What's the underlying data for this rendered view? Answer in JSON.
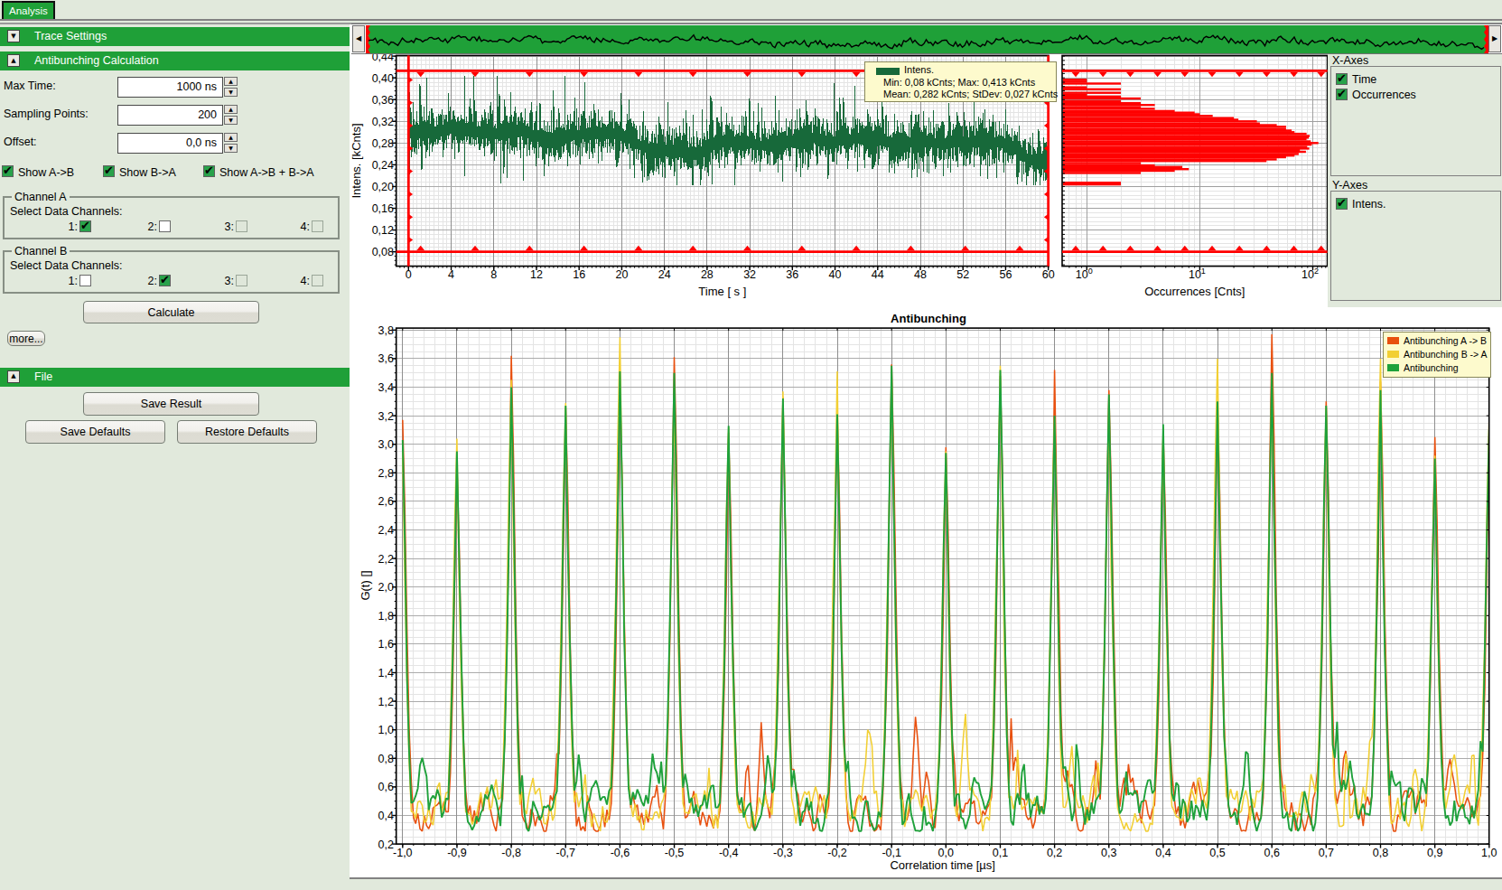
{
  "window": {
    "tab_label": "Analysis"
  },
  "sidebar": {
    "sections": {
      "trace_settings": "Trace Settings",
      "antibunching_calculation": "Antibunching Calculation",
      "file": "File"
    },
    "fields": [
      {
        "label": "Max Time:",
        "value": "1000 ns"
      },
      {
        "label": "Sampling Points:",
        "value": "200"
      },
      {
        "label": "Offset:",
        "value": "0,0 ns"
      }
    ],
    "show_options": [
      {
        "label": "Show A->B",
        "checked": true
      },
      {
        "label": "Show B->A",
        "checked": true
      },
      {
        "label": "Show A->B + B->A",
        "checked": true
      }
    ],
    "channel_a": {
      "title": "Channel A",
      "select_label": "Select Data Channels:",
      "channels": [
        {
          "label": "1:",
          "checked": true,
          "enabled": true
        },
        {
          "label": "2:",
          "checked": false,
          "enabled": true
        },
        {
          "label": "3:",
          "checked": false,
          "enabled": false
        },
        {
          "label": "4:",
          "checked": false,
          "enabled": false
        }
      ]
    },
    "channel_b": {
      "title": "Channel B",
      "select_label": "Select Data Channels:",
      "channels": [
        {
          "label": "1:",
          "checked": false,
          "enabled": true
        },
        {
          "label": "2:",
          "checked": true,
          "enabled": true
        },
        {
          "label": "3:",
          "checked": false,
          "enabled": false
        },
        {
          "label": "4:",
          "checked": false,
          "enabled": false
        }
      ]
    },
    "buttons": {
      "calculate": "Calculate",
      "more": "more...",
      "save_result": "Save Result",
      "save_defaults": "Save Defaults",
      "restore_defaults": "Restore Defaults"
    }
  },
  "axes_panel": {
    "x_title": "X-Axes",
    "x_items": [
      {
        "label": "Time",
        "checked": true
      },
      {
        "label": "Occurrences",
        "checked": true
      }
    ],
    "y_title": "Y-Axes",
    "y_items": [
      {
        "label": "Intens.",
        "checked": true
      }
    ]
  },
  "colors": {
    "accent_green": "#1fa038",
    "trace_dark_green": "#17693a",
    "marker_red": "#ff0000",
    "series_orange": "#e8500f",
    "series_yellow": "#f2cf33",
    "series_green": "#1ea13b",
    "legend_bg": "#fdfacd",
    "panel_bg": "#e1e9dc"
  },
  "chart_data": [
    {
      "id": "overview_trace",
      "type": "line",
      "role": "time-trace overview scrollbar",
      "bg_color": "#1fa038",
      "line_color": "#000000",
      "x_range_s": [
        0,
        60
      ],
      "seed": 101
    },
    {
      "id": "intensity_time_trace",
      "type": "line",
      "title": "",
      "xlabel": "Time [ s ]",
      "ylabel": "Intens. [kCnts]",
      "xlim": [
        -1.15,
        60.05
      ],
      "xticks": [
        0,
        4,
        8,
        12,
        16,
        20,
        24,
        28,
        32,
        36,
        40,
        44,
        48,
        52,
        56,
        60
      ],
      "ylim": [
        0.053,
        0.441
      ],
      "yticks": [
        0.08,
        0.12,
        0.16,
        0.2,
        0.24,
        0.28,
        0.32,
        0.36,
        0.4,
        0.44
      ],
      "grid": true,
      "series": [
        {
          "name": "Intens.",
          "color": "#17693a",
          "min_kcnts": 0.08,
          "max_kcnts": 0.413,
          "mean_kcnts": 0.282,
          "stdev_kcnts": 0.027,
          "sigma": 0.0265,
          "seed": 7,
          "mean_profile": [
            [
              0,
              0.298
            ],
            [
              1,
              0.302
            ],
            [
              3,
              0.3
            ],
            [
              4,
              0.308
            ],
            [
              5,
              0.305
            ],
            [
              6,
              0.302
            ],
            [
              7,
              0.3
            ],
            [
              8,
              0.296
            ],
            [
              9,
              0.3
            ],
            [
              10,
              0.305
            ],
            [
              11,
              0.3
            ],
            [
              12,
              0.292
            ],
            [
              13,
              0.285
            ],
            [
              14,
              0.29
            ],
            [
              15,
              0.298
            ],
            [
              16,
              0.295
            ],
            [
              17,
              0.3
            ],
            [
              18,
              0.3
            ],
            [
              19,
              0.298
            ],
            [
              20,
              0.295
            ],
            [
              21,
              0.285
            ],
            [
              22,
              0.272
            ],
            [
              23,
              0.266
            ],
            [
              24,
              0.264
            ],
            [
              25,
              0.266
            ],
            [
              26,
              0.264
            ],
            [
              27,
              0.262
            ],
            [
              28,
              0.268
            ],
            [
              29,
              0.282
            ],
            [
              30,
              0.284
            ],
            [
              31,
              0.28
            ],
            [
              32,
              0.279
            ],
            [
              33,
              0.276
            ],
            [
              34,
              0.278
            ],
            [
              35,
              0.281
            ],
            [
              36,
              0.284
            ],
            [
              37,
              0.288
            ],
            [
              38,
              0.29
            ],
            [
              39,
              0.285
            ],
            [
              40,
              0.283
            ],
            [
              41,
              0.286
            ],
            [
              42,
              0.289
            ],
            [
              43,
              0.293
            ],
            [
              44,
              0.291
            ],
            [
              45,
              0.282
            ],
            [
              46,
              0.278
            ],
            [
              47,
              0.28
            ],
            [
              48,
              0.283
            ],
            [
              49,
              0.281
            ],
            [
              50,
              0.279
            ],
            [
              51,
              0.283
            ],
            [
              52,
              0.279
            ],
            [
              53,
              0.281
            ],
            [
              54,
              0.284
            ],
            [
              55,
              0.282
            ],
            [
              56,
              0.278
            ],
            [
              57,
              0.268
            ],
            [
              58,
              0.252
            ],
            [
              59,
              0.245
            ],
            [
              60,
              0.238
            ]
          ]
        }
      ],
      "range_cursors": {
        "color": "#ff0000",
        "x_values": [
          0,
          60
        ],
        "y_values": [
          0.08,
          0.413
        ]
      },
      "tooltip": {
        "title": "Intens.",
        "line1": "Min: 0,08 kCnts; Max: 0,413 kCnts",
        "line2": "Mean: 0,282 kCnts; StDev: 0,027 kCnts"
      }
    },
    {
      "id": "intensity_histogram",
      "type": "bar",
      "orientation": "horizontal",
      "xlabel": "Occurrences [Cnts]",
      "x_scale": "log",
      "xticks": [
        1,
        10,
        100
      ],
      "xtick_labels": [
        "10",
        "10",
        "10"
      ],
      "xtick_exponents": [
        "0",
        "1",
        "2"
      ],
      "ylim": [
        0.053,
        0.441
      ],
      "bar_color": "#ff0000",
      "bin_size_kcnts": 0.004,
      "range_cursors": {
        "color": "#ff0000",
        "y_values": [
          0.08,
          0.413
        ]
      },
      "bars_intensity_count": [
        [
          0.204,
          2
        ],
        [
          0.207,
          2
        ],
        [
          0.225,
          3
        ],
        [
          0.229,
          6
        ],
        [
          0.232,
          8
        ],
        [
          0.236,
          7
        ],
        [
          0.239,
          4
        ],
        [
          0.243,
          3
        ],
        [
          0.247,
          39
        ],
        [
          0.25,
          48
        ],
        [
          0.254,
          58
        ],
        [
          0.257,
          69
        ],
        [
          0.26,
          75
        ],
        [
          0.264,
          87
        ],
        [
          0.267,
          77
        ],
        [
          0.27,
          93
        ],
        [
          0.273,
          89
        ],
        [
          0.277,
          98
        ],
        [
          0.28,
          112
        ],
        [
          0.283,
          96
        ],
        [
          0.287,
          88
        ],
        [
          0.29,
          92
        ],
        [
          0.293,
          94
        ],
        [
          0.297,
          88
        ],
        [
          0.3,
          69
        ],
        [
          0.303,
          65
        ],
        [
          0.306,
          58
        ],
        [
          0.31,
          58
        ],
        [
          0.313,
          48
        ],
        [
          0.316,
          34
        ],
        [
          0.32,
          32
        ],
        [
          0.323,
          22
        ],
        [
          0.326,
          20
        ],
        [
          0.33,
          13
        ],
        [
          0.333,
          10
        ],
        [
          0.336,
          9
        ],
        [
          0.339,
          6
        ],
        [
          0.343,
          4
        ],
        [
          0.346,
          3
        ],
        [
          0.35,
          4
        ],
        [
          0.3535,
          3
        ],
        [
          0.357,
          2
        ],
        [
          0.362,
          3
        ],
        [
          0.3655,
          2
        ],
        [
          0.369,
          1
        ],
        [
          0.3725,
          2
        ],
        [
          0.379,
          2
        ],
        [
          0.3825,
          1
        ],
        [
          0.3895,
          2
        ],
        [
          0.393,
          1
        ],
        [
          0.3965,
          1
        ]
      ]
    },
    {
      "id": "antibunching",
      "type": "line",
      "title": "Antibunching",
      "xlabel": "Correlation time [µs]",
      "ylabel": "G(t) []",
      "xlim": [
        -1.0,
        1.0
      ],
      "xtick_step": 0.1,
      "ylim": [
        0.2,
        3.8
      ],
      "ytick_step": 0.2,
      "grid": true,
      "legend_position": "top-right",
      "peak_positions_us": [
        -1.0,
        -0.9,
        -0.8,
        -0.7,
        -0.6,
        -0.5,
        -0.4,
        -0.3,
        -0.2,
        -0.1,
        0.0,
        0.1,
        0.2,
        0.3,
        0.4,
        0.5,
        0.6,
        0.7,
        0.8,
        0.9,
        1.0
      ],
      "peak_decay_us": 0.0102,
      "baseline": 0.43,
      "series": [
        {
          "name": "Antibunching A -> B",
          "color": "#e8500f",
          "seed": 11,
          "peak_heights": [
            3.17,
            2.85,
            3.62,
            3.26,
            3.4,
            3.61,
            3.08,
            3.33,
            3.22,
            3.56,
            2.98,
            3.48,
            3.52,
            3.38,
            3.08,
            3.28,
            3.77,
            3.3,
            3.44,
            3.05,
            3.1
          ]
        },
        {
          "name": "Antibunching B -> A",
          "color": "#f2cf33",
          "seed": 22,
          "peak_heights": [
            2.95,
            3.04,
            3.45,
            3.29,
            3.75,
            3.28,
            3.12,
            3.37,
            3.51,
            3.48,
            2.95,
            3.55,
            3.18,
            3.3,
            3.12,
            3.6,
            3.48,
            3.26,
            3.6,
            2.92,
            3.17
          ]
        },
        {
          "name": "Antibunching",
          "color": "#1ea13b",
          "seed": 33,
          "peak_heights": [
            3.03,
            2.95,
            3.4,
            3.27,
            3.51,
            3.5,
            3.13,
            3.32,
            3.21,
            3.55,
            2.94,
            3.52,
            3.2,
            3.35,
            3.14,
            3.3,
            3.5,
            3.27,
            3.38,
            2.9,
            3.1
          ]
        }
      ]
    }
  ]
}
